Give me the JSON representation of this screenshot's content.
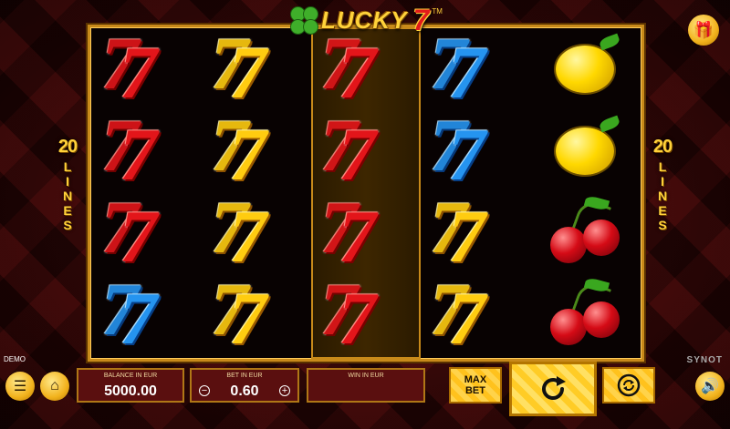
{
  "game": {
    "logo_text": "LUCKY",
    "logo_seven": "7",
    "tm": "TM"
  },
  "lines": {
    "left_num": "20",
    "left_word": "LINES",
    "right_num": "20",
    "right_word": "LINES"
  },
  "reels": [
    [
      "seven-red",
      "seven-red",
      "seven-red",
      "seven-blue"
    ],
    [
      "seven-yellow",
      "seven-yellow",
      "seven-yellow",
      "seven-yellow"
    ],
    [
      "seven-red",
      "seven-red",
      "seven-red",
      "seven-red"
    ],
    [
      "seven-blue",
      "seven-blue",
      "seven-yellow",
      "seven-yellow"
    ],
    [
      "lemon",
      "lemon",
      "cherry",
      "cherry"
    ]
  ],
  "highlighted_reel": 3,
  "footer": {
    "demo_label": "DEMO",
    "brand": "SYNOT",
    "balance_label": "BALANCE IN EUR",
    "balance_value": "5000.00",
    "bet_label": "BET IN EUR",
    "bet_value": "0.60",
    "win_label": "WIN IN EUR",
    "win_value": "",
    "minus": "−",
    "plus": "+",
    "max_bet_line1": "MAX",
    "max_bet_line2": "BET"
  },
  "icons": [
    "menu-icon",
    "home-icon",
    "gift-icon",
    "spin-icon",
    "autoplay-icon",
    "sound-icon"
  ],
  "colors": {
    "accent": "#ffc21d",
    "frame": "#c88a1a",
    "panel": "#5a0f0f"
  }
}
